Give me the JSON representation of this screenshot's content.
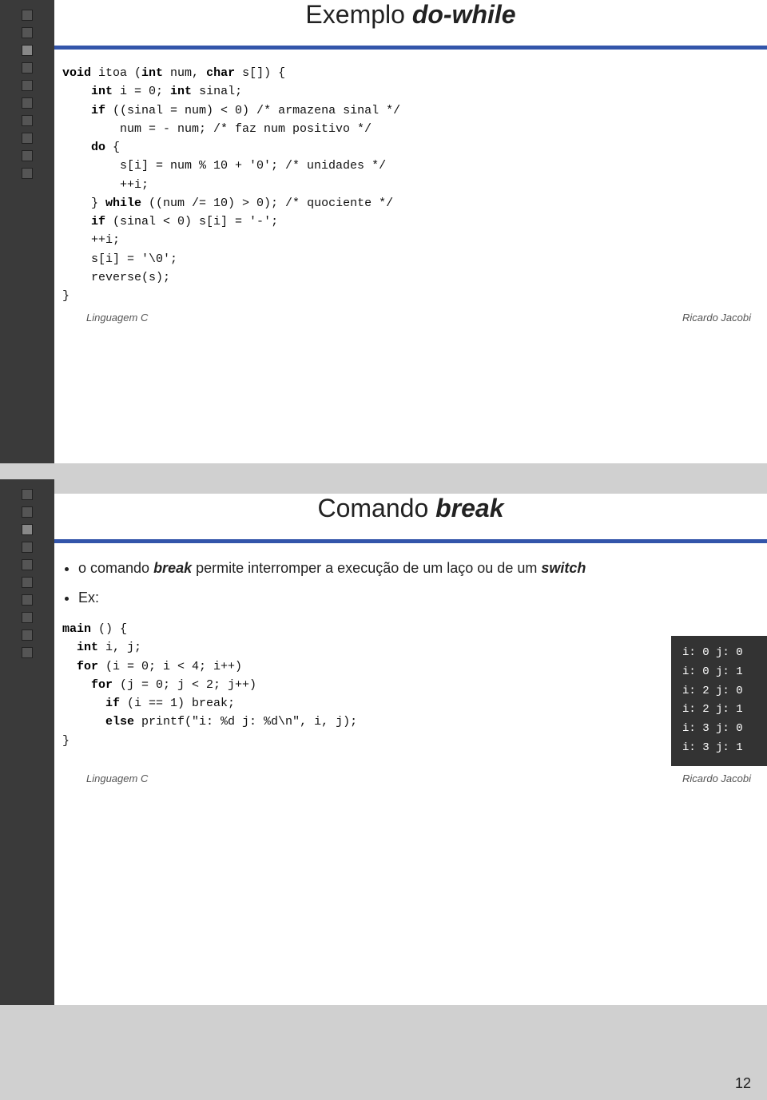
{
  "slide1": {
    "title_normal": "Exemplo ",
    "title_italic": "do-while",
    "code": [
      {
        "html": "<span class='kw'>void</span> itoa (<span class='kw'>int</span> num, <span class='kw'>char</span> s[]) {"
      },
      {
        "html": "    <span class='kw'>int</span> i = 0; <span class='kw'>int</span> sinal;"
      },
      {
        "html": "    <span class='kw'>if</span> ((sinal = num) < 0) /* armazena sinal */"
      },
      {
        "html": "        num = - num; /* faz num positivo */"
      },
      {
        "html": "    <span class='kw'>do</span> {"
      },
      {
        "html": "        s[i] = num % 10 + '0'; /* unidades */"
      },
      {
        "html": "        ++i;"
      },
      {
        "html": "    } <span class='kw'>while</span> ((num /= 10) > 0); /* quociente */"
      },
      {
        "html": "    <span class='kw'>if</span> (sinal < 0) s[i] = '-';"
      },
      {
        "html": "    ++i;"
      },
      {
        "html": "    s[i] = '\\0';"
      },
      {
        "html": "    reverse(s);"
      },
      {
        "html": "}"
      }
    ],
    "footer_left": "Linguagem C",
    "footer_right": "Ricardo Jacobi"
  },
  "slide2": {
    "title_normal": "Comando ",
    "title_italic": "break",
    "bullets": [
      {
        "text_normal": "o comando ",
        "text_italic": "break",
        "text_rest": " permite interromper a execução de um laço ou de um ",
        "text_italic2": "switch"
      },
      {
        "text_normal": "Ex:"
      }
    ],
    "code": [
      {
        "html": "<span class='kw'>main</span> () {"
      },
      {
        "html": "  <span class='kw'>int</span> i, j;"
      },
      {
        "html": "  <span class='kw'>for</span> (i = 0; i < 4; i++)"
      },
      {
        "html": "    <span class='kw'>for</span> (j = 0; j < 2; j++)"
      },
      {
        "html": "      <span class='kw'>if</span> (i == 1) break;"
      },
      {
        "html": "      <span class='kw'>else</span> printf(\"i: %d j: %d\\n\", i, j);"
      },
      {
        "html": "}"
      }
    ],
    "output": [
      "i: 0 j: 0",
      "i: 0 j: 1",
      "i: 2 j: 0",
      "i: 2 j: 1",
      "i: 3 j: 0",
      "i: 3 j: 1"
    ],
    "footer_left": "Linguagem C",
    "footer_right": "Ricardo Jacobi"
  },
  "page_number": "12",
  "sidebar_dots": 10
}
